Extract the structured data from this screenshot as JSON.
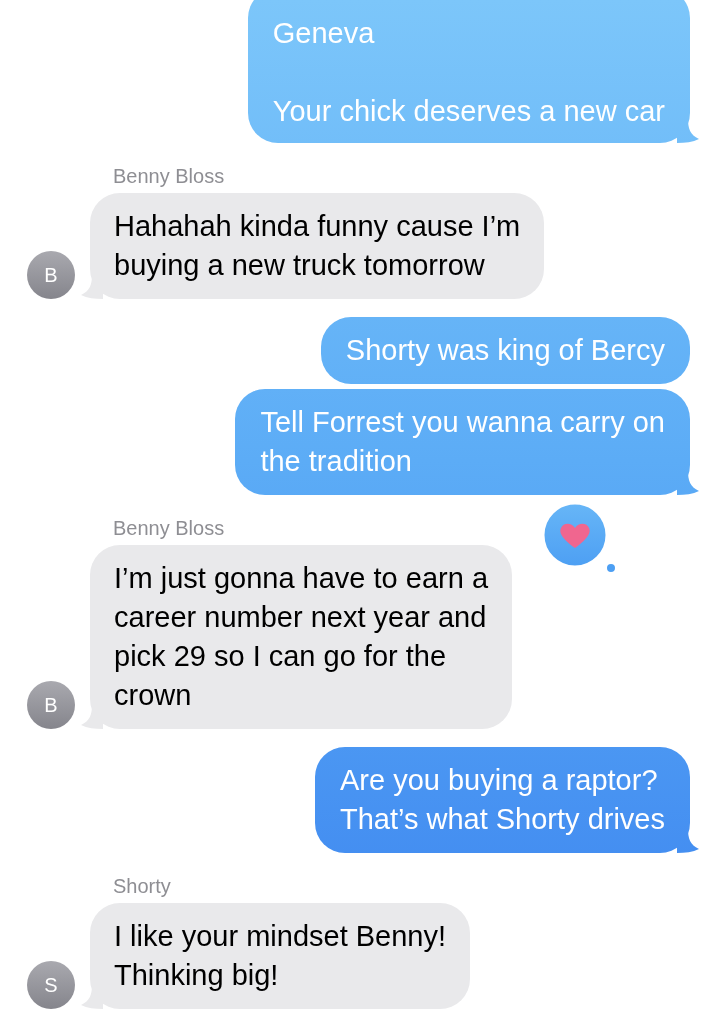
{
  "messages": [
    {
      "kind": "sent",
      "text": "Geneva\n\nYour chick deserves a new car",
      "tail": true
    },
    {
      "kind": "received",
      "sender": "Benny Bloss",
      "avatar": "B",
      "text": "Hahahah kinda funny cause I’m\nbuying a new truck tomorrow",
      "tail": true
    },
    {
      "kind": "sent",
      "text": "Shorty was king of Bercy",
      "tail": false
    },
    {
      "kind": "sent",
      "text": "Tell Forrest you wanna carry on\nthe tradition",
      "tail": true
    },
    {
      "kind": "received",
      "sender": "Benny Bloss",
      "avatar": "B",
      "text": "I’m just gonna have to earn a\ncareer number next year and\npick 29 so I can go for the\ncrown",
      "tail": true,
      "loved": true
    },
    {
      "kind": "sent",
      "text": "Are you buying a raptor?\nThat’s what Shorty drives",
      "tail": true
    },
    {
      "kind": "received",
      "sender": "Shorty",
      "avatar": "S",
      "text": "I like your mindset Benny!\nThinking big!",
      "tail": true
    }
  ]
}
